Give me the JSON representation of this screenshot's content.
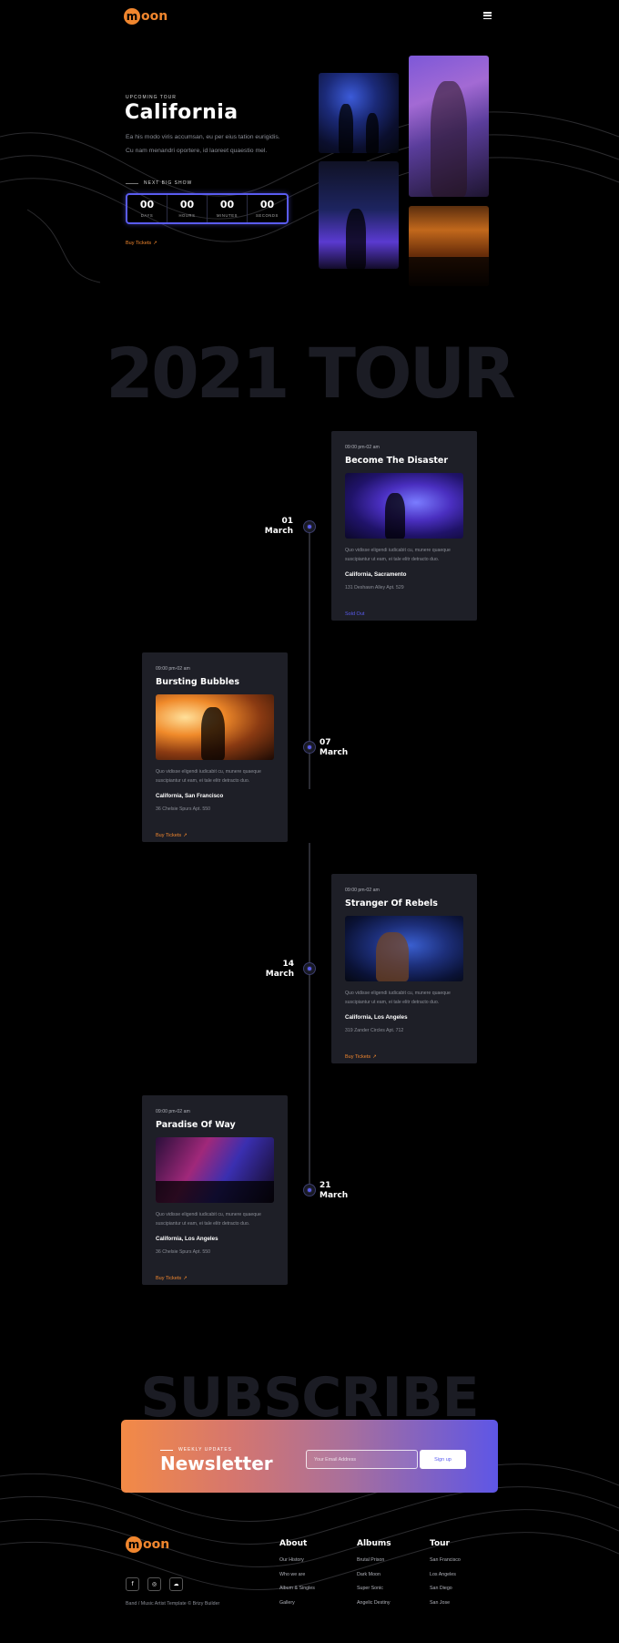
{
  "header": {
    "logo_mark": "m",
    "logo_text": "oon",
    "menu_icon": "hamburger-icon"
  },
  "hero": {
    "eyebrow": "UPCOMING TOUR",
    "title": "California",
    "description": "Ea his modo viris accumsan, eu per eius tation eurigidis. Cu nam menandri oportere, id laoreet quaestio mel.",
    "next_show_label": "NEXT BIG SHOW",
    "countdown": [
      {
        "value": "00",
        "label": "DAYS"
      },
      {
        "value": "00",
        "label": "HOURS"
      },
      {
        "value": "00",
        "label": "MINUTES"
      },
      {
        "value": "00",
        "label": "SECONDS"
      }
    ],
    "buy_label": "Buy Tickets",
    "arrow_icon": "↗"
  },
  "tour": {
    "heading": "2021 TOUR",
    "events": [
      {
        "day": "01",
        "month": "March",
        "time": "09:00 pm-02 am",
        "title": "Become The Disaster",
        "description": "Quo vidisse eligendi iudicabit cu, munere quaeque suscipiantur ut eam, ei tale elitr detracto duo.",
        "location": "California, Sacramento",
        "address": "131 Deshawn Alley Apt. 529",
        "action": "Sold Out"
      },
      {
        "day": "07",
        "month": "March",
        "time": "09:00 pm-02 am",
        "title": "Bursting Bubbles",
        "description": "Quo vidisse eligendi iudicabit cu, munere quaeque suscipiantur ut eam, ei tale elitr detracto duo.",
        "location": "California, San Francisco",
        "address": "36 Chelsie Spurs Apt. 550",
        "action": "Buy Tickets"
      },
      {
        "day": "14",
        "month": "March",
        "time": "09:00 pm-02 am",
        "title": "Stranger Of Rebels",
        "description": "Quo vidisse eligendi iudicabit cu, munere quaeque suscipiantur ut eam, ei tale elitr detracto duo.",
        "location": "California, Los Angeles",
        "address": "319 Zander Circles Apt. 712",
        "action": "Buy Tickets"
      },
      {
        "day": "21",
        "month": "March",
        "time": "09:00 pm-02 am",
        "title": "Paradise Of Way",
        "description": "Quo vidisse eligendi iudicabit cu, munere quaeque suscipiantur ut eam, ei tale elitr detracto duo.",
        "location": "California, Los Angeles",
        "address": "36 Chelsie Spurs Apt. 550",
        "action": "Buy Tickets"
      }
    ]
  },
  "subscribe": {
    "heading": "SUBSCRIBE",
    "eyebrow": "WEEKLY UPDATES",
    "title": "Newsletter",
    "email_placeholder": "Your Email Address",
    "button_label": "Sign up"
  },
  "footer": {
    "social": [
      {
        "icon": "facebook-icon",
        "glyph": "f"
      },
      {
        "icon": "instagram-icon",
        "glyph": "◎"
      },
      {
        "icon": "soundcloud-icon",
        "glyph": "☁"
      }
    ],
    "copyright": "Band / Music Artist Template © Brizy Builder",
    "columns": [
      {
        "title": "About",
        "links": [
          "Our History",
          "Who we are",
          "Album & Singles",
          "Gallery"
        ]
      },
      {
        "title": "Albums",
        "links": [
          "Brutal Prison",
          "Dark Moon",
          "Super Sonic",
          "Angelic Destiny"
        ]
      },
      {
        "title": "Tour",
        "links": [
          "San Francisco",
          "Los Angeles",
          "San Diego",
          "San Jose"
        ]
      }
    ]
  },
  "colors": {
    "accent_orange": "#f0862e",
    "accent_blue": "#5a5cf0",
    "card_bg": "#1e1f27",
    "page_bg": "#000000"
  }
}
